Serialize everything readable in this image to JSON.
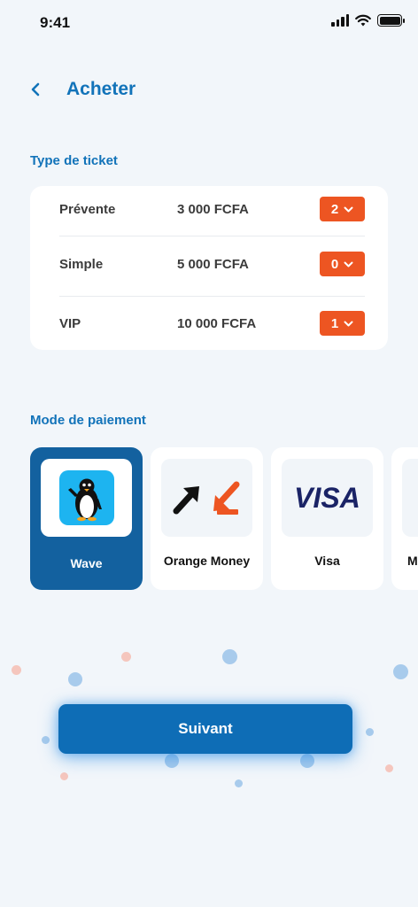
{
  "status_bar": {
    "time": "9:41"
  },
  "header": {
    "title": "Acheter"
  },
  "ticket_section": {
    "title": "Type de ticket",
    "tickets": [
      {
        "name": "Prévente",
        "price": "3 000 FCFA",
        "quantity": "2"
      },
      {
        "name": "Simple",
        "price": "5 000 FCFA",
        "quantity": "0"
      },
      {
        "name": "VIP",
        "price": "10 000 FCFA",
        "quantity": "1"
      }
    ]
  },
  "payment_section": {
    "title": "Mode de paiement",
    "methods": [
      {
        "label": "Wave",
        "selected": true
      },
      {
        "label": "Orange Money",
        "selected": false
      },
      {
        "label": "Visa",
        "selected": false,
        "logo_text": "VISA"
      },
      {
        "label": "M",
        "selected": false
      }
    ]
  },
  "actions": {
    "next_label": "Suivant"
  },
  "colors": {
    "primary": "#1273b9",
    "accent": "#ed5522",
    "selected_card": "#13619f",
    "button": "#0e6db6"
  }
}
